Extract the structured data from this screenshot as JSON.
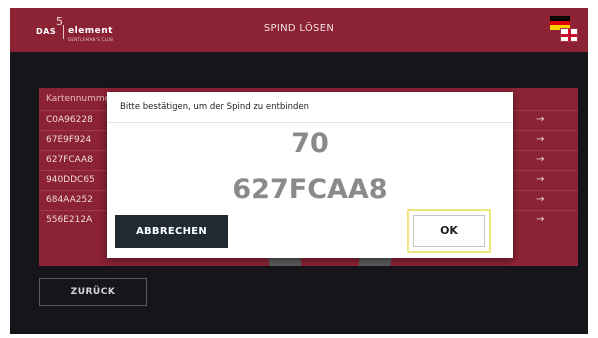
{
  "header": {
    "logo": {
      "das": "DAS",
      "element": "element",
      "tagline": "GENTLEMAN'S CLUB"
    },
    "title": "SPIND LÖSEN",
    "language_icon": "de-en-flag-icon"
  },
  "table": {
    "header": "Kartennumme",
    "rows": [
      {
        "code": "C0A96228",
        "arrow": "→"
      },
      {
        "code": "67E9F924",
        "arrow": "→"
      },
      {
        "code": "627FCAA8",
        "arrow": "→"
      },
      {
        "code": "940DDC65",
        "arrow": "→"
      },
      {
        "code": "684AA252",
        "arrow": "→"
      },
      {
        "code": "556E212A",
        "arrow": "→"
      }
    ]
  },
  "back_button": "ZURÜCK",
  "modal": {
    "message": "Bitte bestätigen, um der Spind zu entbinden",
    "locker_number": "70",
    "card_number": "627FCAA8",
    "cancel_label": "ABBRECHEN",
    "ok_label": "OK"
  },
  "colors": {
    "brand": "#8b2335",
    "background": "#16161a",
    "dark_button": "#1f2a33",
    "focus_highlight": "#f0e47a"
  }
}
